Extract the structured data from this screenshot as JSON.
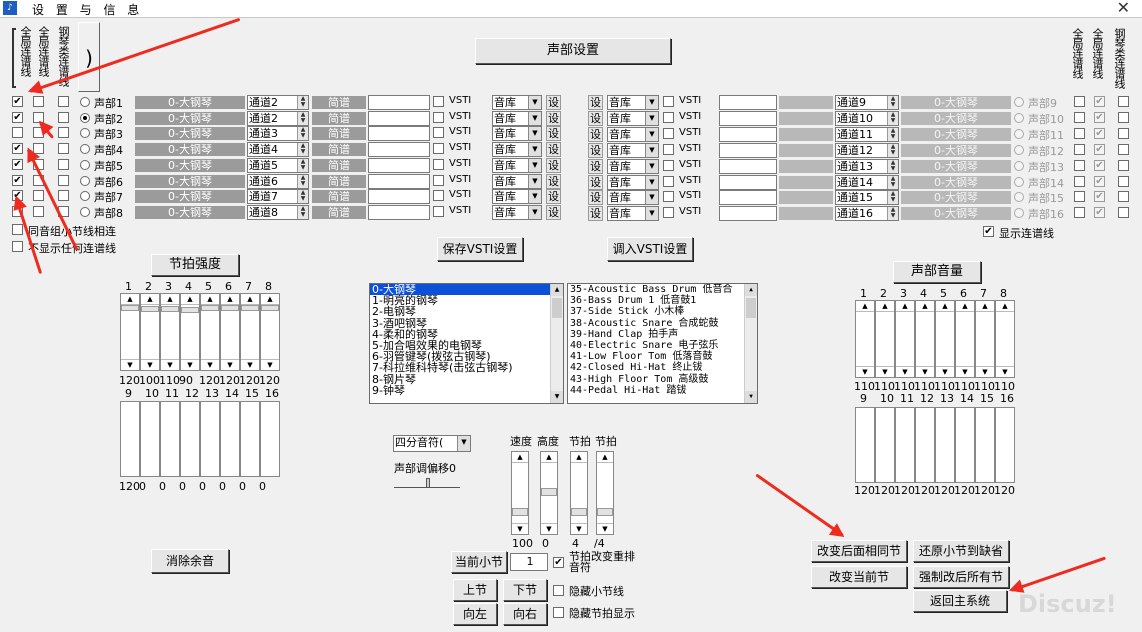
{
  "window": {
    "title": "设 置 与 信 息",
    "close": "✕"
  },
  "top_left_headers": [
    "全局连谱线",
    "全局连谱线",
    "钢琴类连谱线"
  ],
  "top_right_headers": [
    "全局连谱线",
    "全局连谱线",
    "钢琴类连谱线"
  ],
  "part_settings_button": "声部设置",
  "left_parts": [
    {
      "label": "声部1",
      "instrument": "0-大钢琴",
      "channel": "通道2",
      "score": "简谱",
      "vsti": "VSTI",
      "lib": "音库",
      "set": "设",
      "selected": false,
      "c1": true,
      "c2": false,
      "c3": false
    },
    {
      "label": "声部2",
      "instrument": "0-大钢琴",
      "channel": "通道2",
      "score": "简谱",
      "vsti": "VSTI",
      "lib": "音库",
      "set": "设",
      "selected": true,
      "c1": true,
      "c2": false,
      "c3": false
    },
    {
      "label": "声部3",
      "instrument": "0-大钢琴",
      "channel": "通道3",
      "score": "简谱",
      "vsti": "VSTI",
      "lib": "音库",
      "set": "设",
      "selected": false,
      "c1": false,
      "c2": false,
      "c3": false
    },
    {
      "label": "声部4",
      "instrument": "0-大钢琴",
      "channel": "通道4",
      "score": "简谱",
      "vsti": "VSTI",
      "lib": "音库",
      "set": "设",
      "selected": false,
      "c1": true,
      "c2": false,
      "c3": false
    },
    {
      "label": "声部5",
      "instrument": "0-大钢琴",
      "channel": "通道5",
      "score": "简谱",
      "vsti": "VSTI",
      "lib": "音库",
      "set": "设",
      "selected": false,
      "c1": true,
      "c2": false,
      "c3": false
    },
    {
      "label": "声部6",
      "instrument": "0-大钢琴",
      "channel": "通道6",
      "score": "简谱",
      "vsti": "VSTI",
      "lib": "音库",
      "set": "设",
      "selected": false,
      "c1": true,
      "c2": false,
      "c3": false
    },
    {
      "label": "声部7",
      "instrument": "0-大钢琴",
      "channel": "通道7",
      "score": "简谱",
      "vsti": "VSTI",
      "lib": "音库",
      "set": "设",
      "selected": false,
      "c1": true,
      "c2": false,
      "c3": false
    },
    {
      "label": "声部8",
      "instrument": "0-大钢琴",
      "channel": "通道8",
      "score": "简谱",
      "vsti": "VSTI",
      "lib": "音库",
      "set": "设",
      "selected": false,
      "c1": false,
      "c2": false,
      "c3": false
    }
  ],
  "right_parts": [
    {
      "label": "声部9",
      "instrument": "0-大钢琴",
      "channel": "通道9",
      "set": "设",
      "lib": "音库",
      "vsti": "VSTI"
    },
    {
      "label": "声部10",
      "instrument": "0-大钢琴",
      "channel": "通道10",
      "set": "设",
      "lib": "音库",
      "vsti": "VSTI"
    },
    {
      "label": "声部11",
      "instrument": "0-大钢琴",
      "channel": "通道11",
      "set": "设",
      "lib": "音库",
      "vsti": "VSTI"
    },
    {
      "label": "声部12",
      "instrument": "0-大钢琴",
      "channel": "通道12",
      "set": "设",
      "lib": "音库",
      "vsti": "VSTI"
    },
    {
      "label": "声部13",
      "instrument": "0-大钢琴",
      "channel": "通道13",
      "set": "设",
      "lib": "音库",
      "vsti": "VSTI"
    },
    {
      "label": "声部14",
      "instrument": "0-大钢琴",
      "channel": "通道14",
      "set": "设",
      "lib": "音库",
      "vsti": "VSTI"
    },
    {
      "label": "声部15",
      "instrument": "0-大钢琴",
      "channel": "通道15",
      "set": "设",
      "lib": "音库",
      "vsti": "VSTI"
    },
    {
      "label": "声部16",
      "instrument": "0-大钢琴",
      "channel": "通道16",
      "set": "设",
      "lib": "音库",
      "vsti": "VSTI"
    }
  ],
  "same_group_bar_connect": "同音组小节线相连",
  "hide_all_connect": "不显示任何连谱线",
  "show_connect": "显示连谱线",
  "save_vsti": "保存VSTI设置",
  "load_vsti": "调入VSTI设置",
  "beat_strength": {
    "title": "节拍强度",
    "top_numbers": [
      "1",
      "2",
      "3",
      "4",
      "5",
      "6",
      "7",
      "8"
    ],
    "top_values": [
      "120",
      "100",
      "110",
      "90",
      "120",
      "120",
      "120",
      "120"
    ],
    "top_levels": [
      1.0,
      0.83,
      0.92,
      0.75,
      1.0,
      1.0,
      1.0,
      1.0
    ],
    "bottom_numbers": [
      "9",
      "10",
      "11",
      "12",
      "13",
      "14",
      "15",
      "16"
    ],
    "bottom_values": [
      "120",
      "0",
      "0",
      "0",
      "0",
      "0",
      "0",
      "0"
    ]
  },
  "part_volume": {
    "title": "声部音量",
    "top_numbers": [
      "1",
      "2",
      "3",
      "4",
      "5",
      "6",
      "7",
      "8"
    ],
    "top_values": [
      "110",
      "110",
      "110",
      "110",
      "110",
      "110",
      "110",
      "110"
    ],
    "bottom_numbers": [
      "9",
      "10",
      "11",
      "12",
      "13",
      "14",
      "15",
      "16"
    ],
    "bottom_values": [
      "120",
      "120",
      "120",
      "120",
      "120",
      "120",
      "120",
      "120"
    ]
  },
  "instrument_list": [
    "0-大钢琴",
    "1-明亮的钢琴",
    "2-电钢琴",
    "3-酒吧钢琴",
    "4-柔和的钢琴",
    "5-加合唱效果的电钢琴",
    "6-羽管键琴(拨弦古钢琴)",
    "7-科拉维科特琴(击弦古钢琴)",
    "8-钢片琴",
    "9-钟琴"
  ],
  "drum_list": [
    "35-Acoustic Bass Drum  低音合",
    "36-Bass Drum 1 低音鼓1",
    "37-Side Stick 小木棒",
    "38-Acoustic Snare 合成蛇鼓",
    "39-Hand Clap 拍手声",
    "40-Electric Snare 电子弦乐",
    "41-Low Floor Tom 低落音鼓",
    "42-Closed Hi-Hat 终止钹",
    "43-High Floor Tom 高级鼓",
    "44-Pedal Hi-Hat 踏钹"
  ],
  "note_combo": "四分音符(",
  "part_offset": "声部调偏移0",
  "speed": {
    "label": "速度",
    "value": "100"
  },
  "pitch": {
    "label": "高度",
    "value": "0"
  },
  "beat": {
    "label": "节拍",
    "value": "4"
  },
  "beat2": {
    "label": "节拍",
    "value": "/4"
  },
  "clear_echo": "消除余音",
  "current_bar": "当前小节",
  "current_bar_value": "1",
  "beat_change_rearrange": "节拍改变重排音符",
  "prev_bar": "上节",
  "next_bar": "下节",
  "left": "向左",
  "right": "向右",
  "hide_bar_line": "隐藏小节线",
  "hide_beat_display": "隐藏节拍显示",
  "change_following": "改变后面相同节",
  "restore_bar": "还原小节到缺省",
  "change_current": "改变当前节",
  "force_change": "强制改后所有节",
  "back_main": "返回主系统",
  "watermark": "Discuz!",
  "arrow_color": "#ee2b1f"
}
